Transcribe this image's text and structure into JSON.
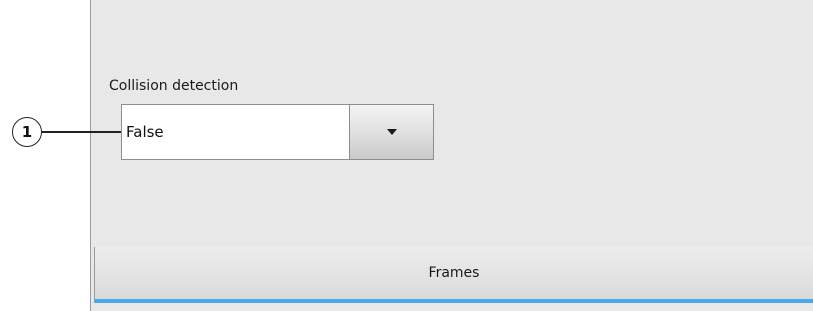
{
  "collision": {
    "label": "Collision detection",
    "selected_value": "False",
    "dropdown_icon": "triangle-down-icon"
  },
  "callout": {
    "number": "1"
  },
  "tab": {
    "label": "Frames",
    "accent_color": "#4aa8e6"
  }
}
